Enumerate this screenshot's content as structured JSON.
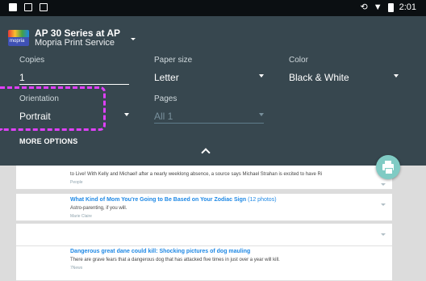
{
  "status_bar": {
    "time": "2:01"
  },
  "printer": {
    "name": "AP 30 Series at AP",
    "service": "Mopria Print Service",
    "logo_text": "mopria"
  },
  "fields": {
    "copies": {
      "label": "Copies",
      "value": "1"
    },
    "paper_size": {
      "label": "Paper size",
      "value": "Letter"
    },
    "color": {
      "label": "Color",
      "value": "Black & White"
    },
    "orientation": {
      "label": "Orientation",
      "value": "Portrait"
    },
    "pages": {
      "label": "Pages",
      "value": "All 1"
    }
  },
  "more_options": "MORE OPTIONS",
  "feed": [
    {
      "title": "",
      "desc": "to Live! With Kelly and Michael! after a nearly weeklong absence, a source says Michael Strahan is excited to have Ri",
      "source": "People"
    },
    {
      "title": "What Kind of Mom You're Going to Be Based on Your Zodiac Sign",
      "count": "(12 photos)",
      "desc": "Astro-parenting, if you will.",
      "source": "Marie Claire"
    },
    {
      "title": "Dangerous great dane could kill: Shocking pictures of dog mauling",
      "desc": "There are grave fears that a dangerous dog that has attacked five times in just over a year will kill.",
      "source": "7News"
    }
  ],
  "colors": {
    "panel": "#37474f",
    "status_bar": "#0b0f12",
    "fab": "#80cbc4",
    "highlight": "#e040fb",
    "link": "#1e88e5"
  }
}
